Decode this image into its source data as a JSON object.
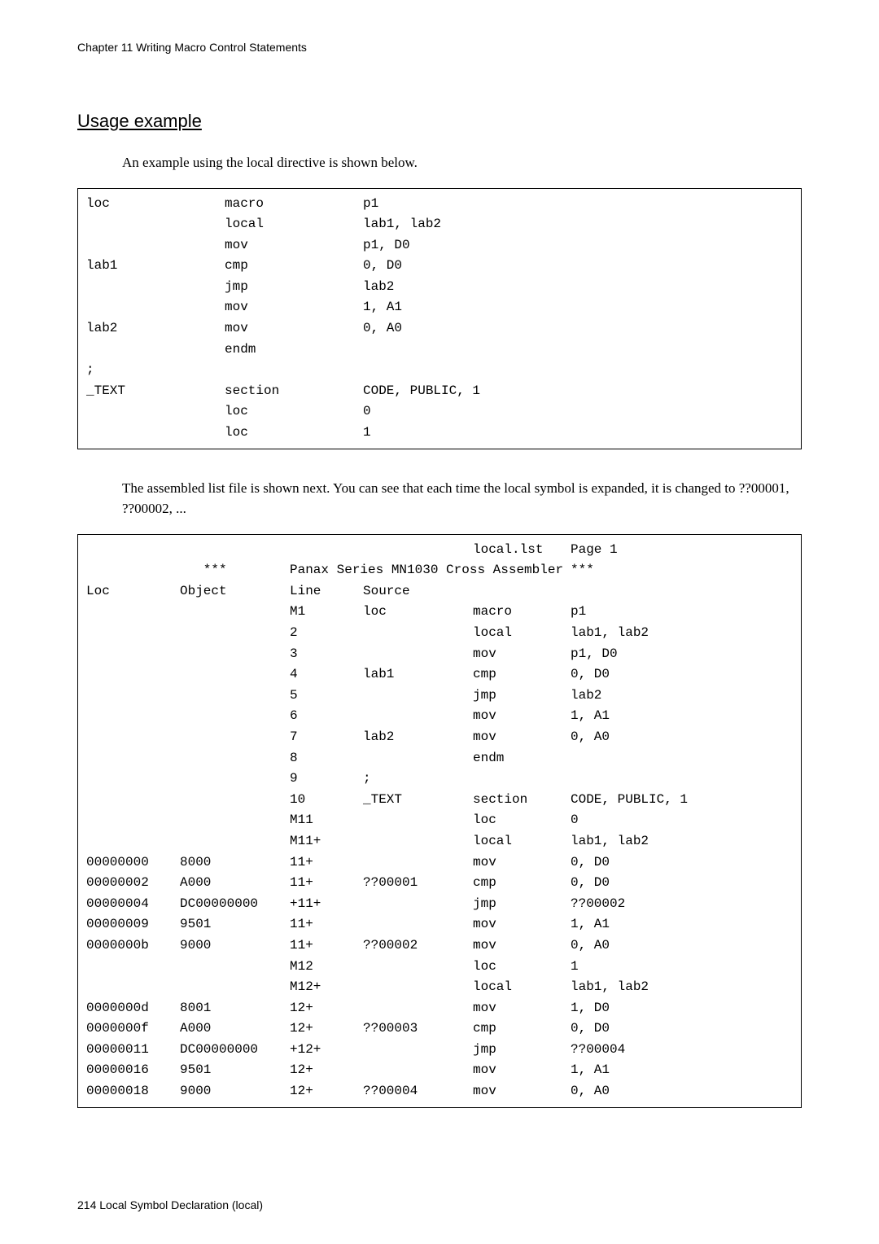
{
  "header": "Chapter 11    Writing Macro Control Statements",
  "section_title": "Usage example",
  "intro": "An example using the local directive is shown below.",
  "code1": {
    "rows": [
      {
        "a": "loc",
        "b": "macro",
        "c": "p1"
      },
      {
        "a": "",
        "b": "local",
        "c": "lab1, lab2"
      },
      {
        "a": "",
        "b": "mov",
        "c": "p1, D0"
      },
      {
        "a": "lab1",
        "b": "cmp",
        "c": "0, D0"
      },
      {
        "a": "",
        "b": "jmp",
        "c": "lab2"
      },
      {
        "a": "",
        "b": "mov",
        "c": "1, A1"
      },
      {
        "a": "lab2",
        "b": "mov",
        "c": "0, A0"
      },
      {
        "a": "",
        "b": "endm",
        "c": ""
      },
      {
        "a": ";",
        "b": "",
        "c": ""
      },
      {
        "a": "_TEXT",
        "b": "section",
        "c": "CODE, PUBLIC, 1"
      },
      {
        "a": "",
        "b": "loc",
        "c": "0"
      },
      {
        "a": "",
        "b": "loc",
        "c": "1"
      }
    ]
  },
  "mid_text": "The assembled list file is shown next. You can see that each time the local symbol is expanded, it is changed to ??00001, ??00002, ...",
  "listing": {
    "title_right1": "local.lst",
    "title_right2": "Page 1",
    "subtitle_left": "***",
    "subtitle_mid": "Panax Series MN1030 Cross Assembler",
    "subtitle_right": "***",
    "cols": {
      "loc": "Loc",
      "obj": "Object",
      "line": "Line",
      "src": "Source"
    },
    "rows": [
      {
        "loc": "",
        "obj": "",
        "line": "M1",
        "src": "loc",
        "op": "macro",
        "arg": "p1"
      },
      {
        "loc": "",
        "obj": "",
        "line": "2",
        "src": "",
        "op": "local",
        "arg": "lab1, lab2"
      },
      {
        "loc": "",
        "obj": "",
        "line": "3",
        "src": "",
        "op": "mov",
        "arg": "p1, D0"
      },
      {
        "loc": "",
        "obj": "",
        "line": "4",
        "src": "lab1",
        "op": "cmp",
        "arg": "0, D0"
      },
      {
        "loc": "",
        "obj": "",
        "line": "5",
        "src": "",
        "op": "jmp",
        "arg": "lab2"
      },
      {
        "loc": "",
        "obj": "",
        "line": "6",
        "src": "",
        "op": "mov",
        "arg": "1, A1"
      },
      {
        "loc": "",
        "obj": "",
        "line": "7",
        "src": "lab2",
        "op": "mov",
        "arg": "0, A0"
      },
      {
        "loc": "",
        "obj": "",
        "line": "8",
        "src": "",
        "op": "endm",
        "arg": ""
      },
      {
        "loc": "",
        "obj": "",
        "line": "9",
        "src": ";",
        "op": "",
        "arg": ""
      },
      {
        "loc": "",
        "obj": "",
        "line": "10",
        "src": "_TEXT",
        "op": "section",
        "arg": "CODE, PUBLIC, 1"
      },
      {
        "loc": "",
        "obj": "",
        "line": "M11",
        "src": "",
        "op": "loc",
        "arg": "0"
      },
      {
        "loc": "",
        "obj": "",
        "line": "M11+",
        "src": "",
        "op": "local",
        "arg": "lab1, lab2"
      },
      {
        "loc": "00000000",
        "obj": "8000",
        "line": "11+",
        "src": "",
        "op": "mov",
        "arg": "0, D0"
      },
      {
        "loc": "00000002",
        "obj": "A000",
        "line": "11+",
        "src": "??00001",
        "op": "cmp",
        "arg": "0, D0"
      },
      {
        "loc": "00000004",
        "obj": "DC00000000",
        "line": "+11+",
        "src": "",
        "op": "jmp",
        "arg": "??00002"
      },
      {
        "loc": "00000009",
        "obj": "9501",
        "line": "11+",
        "src": "",
        "op": "mov",
        "arg": "1, A1"
      },
      {
        "loc": "0000000b",
        "obj": "9000",
        "line": "11+",
        "src": "??00002",
        "op": "mov",
        "arg": "0, A0"
      },
      {
        "loc": "",
        "obj": "",
        "line": "M12",
        "src": "",
        "op": "loc",
        "arg": "1"
      },
      {
        "loc": "",
        "obj": "",
        "line": "M12+",
        "src": "",
        "op": "local",
        "arg": "lab1, lab2"
      },
      {
        "loc": "0000000d",
        "obj": "8001",
        "line": "12+",
        "src": "",
        "op": "mov",
        "arg": "1, D0"
      },
      {
        "loc": "0000000f",
        "obj": "A000",
        "line": "12+",
        "src": "??00003",
        "op": "cmp",
        "arg": "0, D0"
      },
      {
        "loc": "00000011",
        "obj": "DC00000000",
        "line": "+12+",
        "src": "",
        "op": "jmp",
        "arg": "??00004"
      },
      {
        "loc": "00000016",
        "obj": "9501",
        "line": "12+",
        "src": "",
        "op": "mov",
        "arg": "1, A1"
      },
      {
        "loc": "00000018",
        "obj": "9000",
        "line": "12+",
        "src": "??00004",
        "op": "mov",
        "arg": "0, A0"
      }
    ]
  },
  "footer": "214  Local Symbol Declaration (local)"
}
